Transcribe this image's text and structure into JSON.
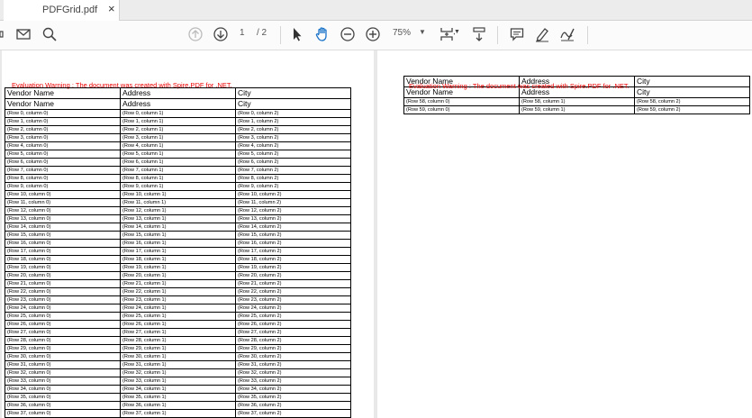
{
  "tab": {
    "title": "PDFGrid.pdf",
    "close": "×"
  },
  "toolbar": {
    "page_current": "1",
    "page_total": "/ 2",
    "zoom": "75%"
  },
  "pdf": {
    "warning": "Evaluation Warning : The document was created with Spire.PDF for .NET.",
    "headers": [
      "Vendor Name",
      "Address",
      "City"
    ],
    "page1_rows": [
      [
        "(Row 0, column 0)",
        "(Row 0, column 1)",
        "(Row 0, column 2)"
      ],
      [
        "(Row 1, column 0)",
        "(Row 1, column 1)",
        "(Row 1, column 2)"
      ],
      [
        "(Row 2, column 0)",
        "(Row 2, column 1)",
        "(Row 2, column 2)"
      ],
      [
        "(Row 3, column 0)",
        "(Row 3, column 1)",
        "(Row 3, column 2)"
      ],
      [
        "(Row 4, column 0)",
        "(Row 4, column 1)",
        "(Row 4, column 2)"
      ],
      [
        "(Row 5, column 0)",
        "(Row 5, column 1)",
        "(Row 5, column 2)"
      ],
      [
        "(Row 6, column 0)",
        "(Row 6, column 1)",
        "(Row 6, column 2)"
      ],
      [
        "(Row 7, column 0)",
        "(Row 7, column 1)",
        "(Row 7, column 2)"
      ],
      [
        "(Row 8, column 0)",
        "(Row 8, column 1)",
        "(Row 8, column 2)"
      ],
      [
        "(Row 9, column 0)",
        "(Row 9, column 1)",
        "(Row 9, column 2)"
      ],
      [
        "(Row 10, column 0)",
        "(Row 10, column 1)",
        "(Row 10, column 2)"
      ],
      [
        "(Row 11, column 0)",
        "(Row 11, column 1)",
        "(Row 11, column 2)"
      ],
      [
        "(Row 12, column 0)",
        "(Row 12, column 1)",
        "(Row 12, column 2)"
      ],
      [
        "(Row 13, column 0)",
        "(Row 13, column 1)",
        "(Row 13, column 2)"
      ],
      [
        "(Row 14, column 0)",
        "(Row 14, column 1)",
        "(Row 14, column 2)"
      ],
      [
        "(Row 15, column 0)",
        "(Row 15, column 1)",
        "(Row 15, column 2)"
      ],
      [
        "(Row 16, column 0)",
        "(Row 16, column 1)",
        "(Row 16, column 2)"
      ],
      [
        "(Row 17, column 0)",
        "(Row 17, column 1)",
        "(Row 17, column 2)"
      ],
      [
        "(Row 18, column 0)",
        "(Row 18, column 1)",
        "(Row 18, column 2)"
      ],
      [
        "(Row 19, column 0)",
        "(Row 19, column 1)",
        "(Row 19, column 2)"
      ],
      [
        "(Row 20, column 0)",
        "(Row 20, column 1)",
        "(Row 20, column 2)"
      ],
      [
        "(Row 21, column 0)",
        "(Row 21, column 1)",
        "(Row 21, column 2)"
      ],
      [
        "(Row 22, column 0)",
        "(Row 22, column 1)",
        "(Row 22, column 2)"
      ],
      [
        "(Row 23, column 0)",
        "(Row 23, column 1)",
        "(Row 23, column 2)"
      ],
      [
        "(Row 24, column 0)",
        "(Row 24, column 1)",
        "(Row 24, column 2)"
      ],
      [
        "(Row 25, column 0)",
        "(Row 25, column 1)",
        "(Row 25, column 2)"
      ],
      [
        "(Row 26, column 0)",
        "(Row 26, column 1)",
        "(Row 26, column 2)"
      ],
      [
        "(Row 27, column 0)",
        "(Row 27, column 1)",
        "(Row 27, column 2)"
      ],
      [
        "(Row 28, column 0)",
        "(Row 28, column 1)",
        "(Row 28, column 2)"
      ],
      [
        "(Row 29, column 0)",
        "(Row 29, column 1)",
        "(Row 29, column 2)"
      ],
      [
        "(Row 30, column 0)",
        "(Row 30, column 1)",
        "(Row 30, column 2)"
      ],
      [
        "(Row 31, column 0)",
        "(Row 31, column 1)",
        "(Row 31, column 2)"
      ],
      [
        "(Row 32, column 0)",
        "(Row 32, column 1)",
        "(Row 32, column 2)"
      ],
      [
        "(Row 33, column 0)",
        "(Row 33, column 1)",
        "(Row 33, column 2)"
      ],
      [
        "(Row 34, column 0)",
        "(Row 34, column 1)",
        "(Row 34, column 2)"
      ],
      [
        "(Row 35, column 0)",
        "(Row 35, column 1)",
        "(Row 35, column 2)"
      ],
      [
        "(Row 36, column 0)",
        "(Row 36, column 1)",
        "(Row 36, column 2)"
      ],
      [
        "(Row 37, column 0)",
        "(Row 37, column 1)",
        "(Row 37, column 2)"
      ]
    ],
    "page2_rows": [
      [
        "(Row 58, column 0)",
        "(Row 58, column 1)",
        "(Row 58, column 2)"
      ],
      [
        "(Row 59, column 0)",
        "(Row 59, column 1)",
        "(Row 59, column 2)"
      ]
    ]
  }
}
